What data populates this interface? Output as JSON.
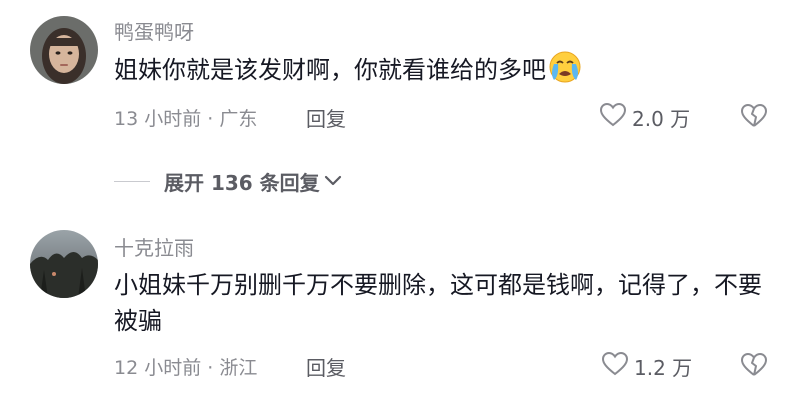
{
  "comments": [
    {
      "username": "鸭蛋鸭呀",
      "text": "姐妹你就是该发财啊，你就看谁给的多吧",
      "emoji": "crying-face-icon",
      "meta": "13 小时前 · 广东",
      "reply_label": "回复",
      "likes": "2.0 万"
    },
    {
      "username": "十克拉雨",
      "text": "小姐妹千万别删千万不要删除，这可都是钱啊，记得了，不要被骗",
      "meta": "12 小时前 · 浙江",
      "reply_label": "回复",
      "likes": "1.2 万"
    }
  ],
  "expand_replies": {
    "label": "展开 136 条回复"
  },
  "colors": {
    "secondary_text": "#8a8b91",
    "primary_text": "#161823",
    "action_text": "#5b5c63"
  }
}
